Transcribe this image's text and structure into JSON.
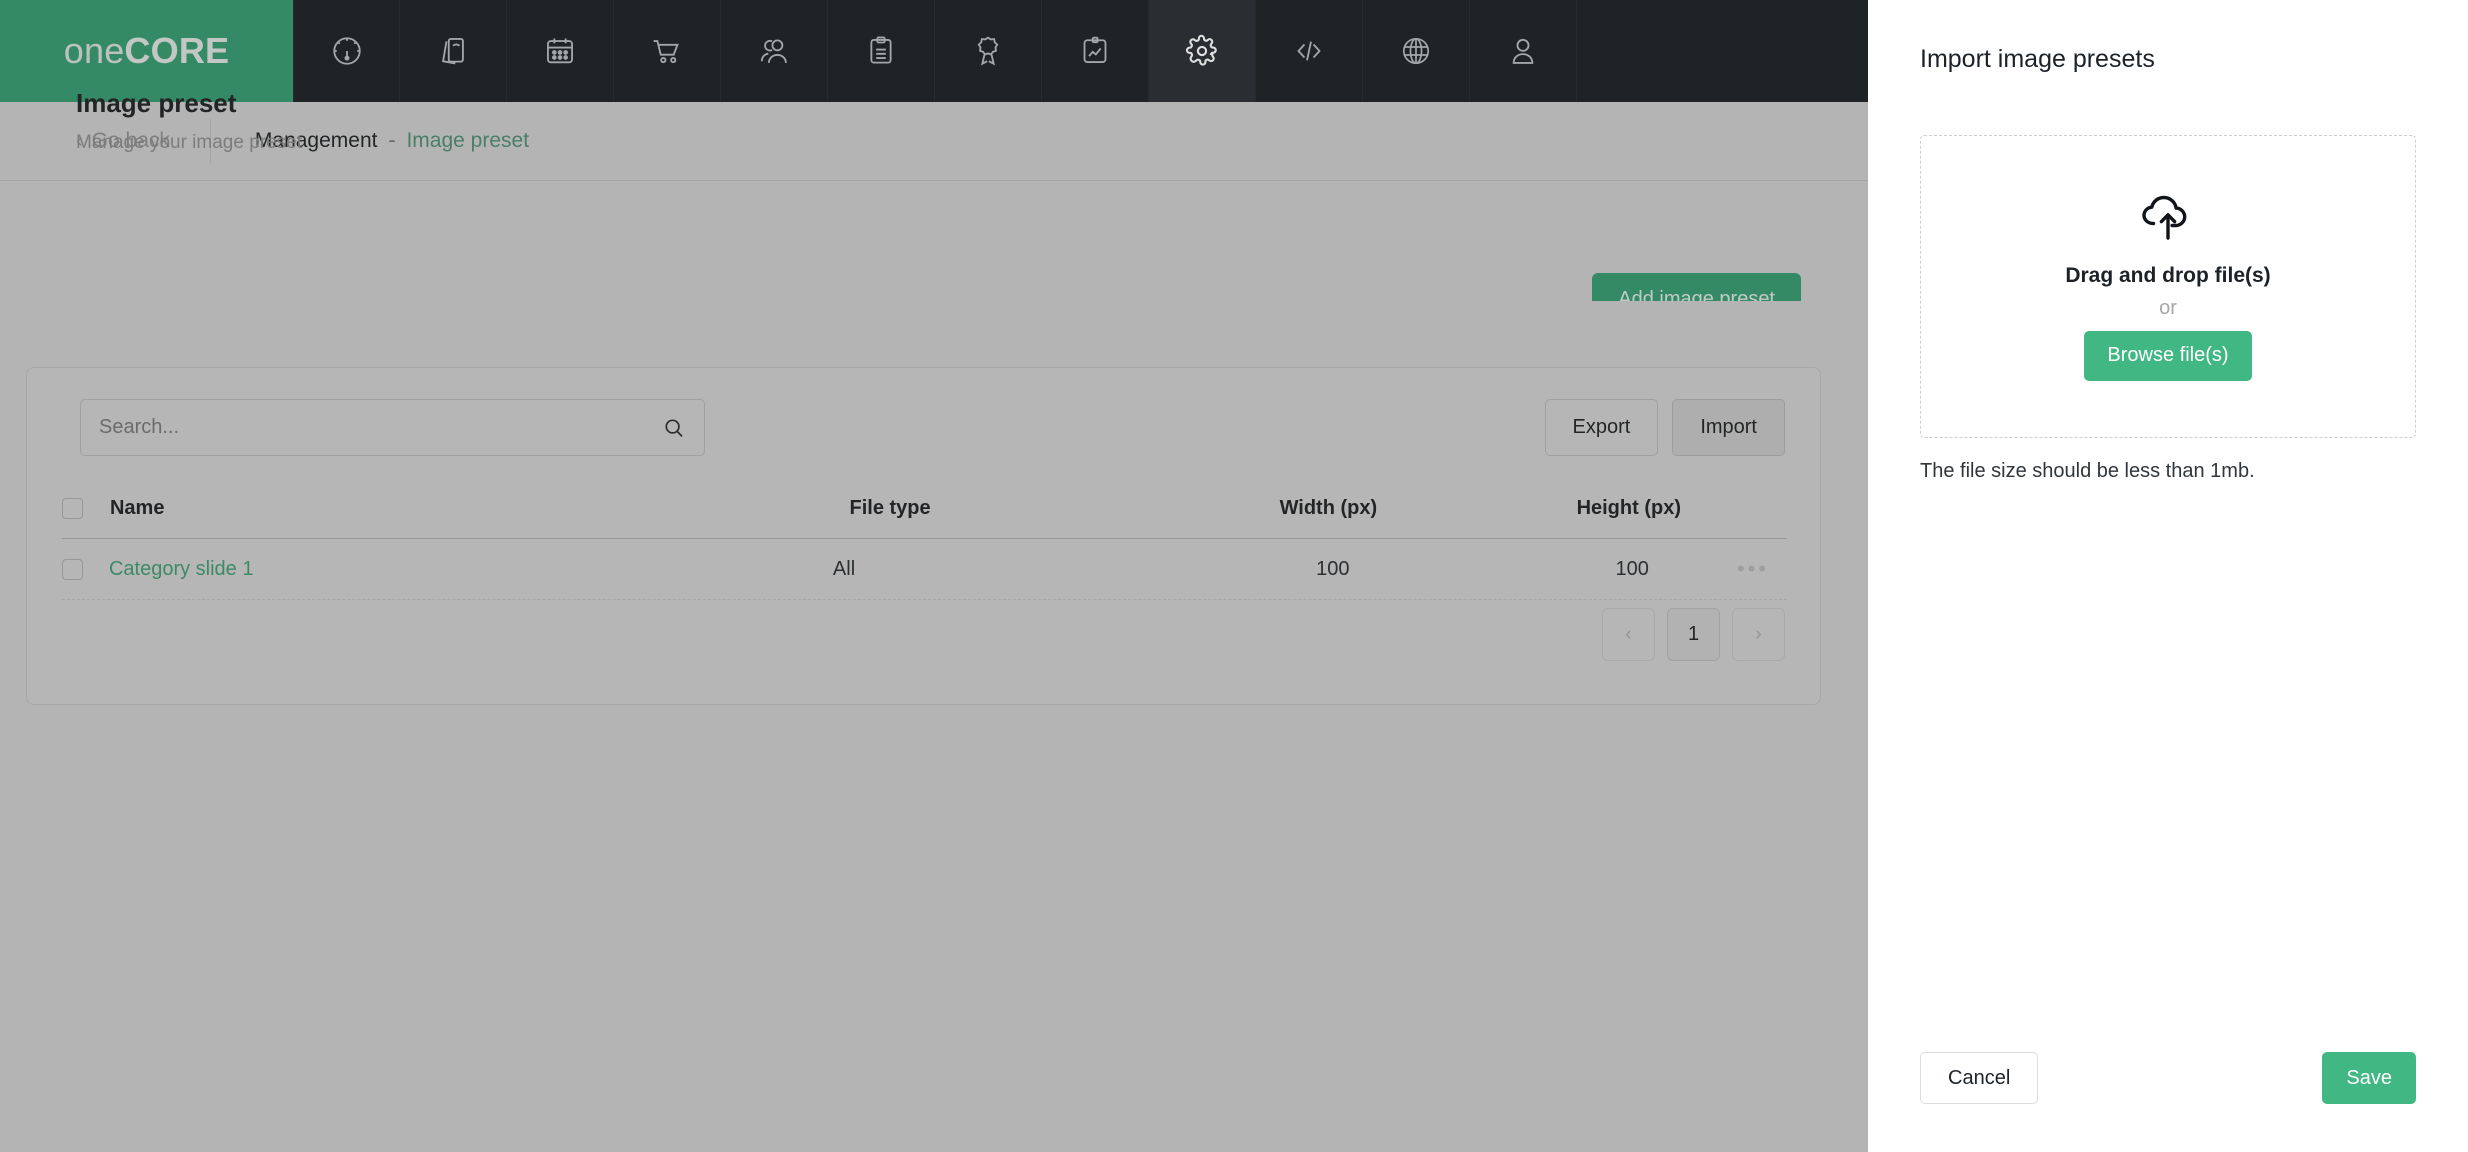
{
  "brand": {
    "prefix": "one",
    "suffix": "CORE"
  },
  "nav": {
    "items": [
      {
        "name": "dashboard",
        "icon": "speedometer-icon",
        "active": false
      },
      {
        "name": "catalog",
        "icon": "pages-icon",
        "active": false
      },
      {
        "name": "calendar",
        "icon": "calendar-icon",
        "active": false
      },
      {
        "name": "orders",
        "icon": "shopping-cart-icon",
        "active": false
      },
      {
        "name": "customers",
        "icon": "users-icon",
        "active": false
      },
      {
        "name": "tasks",
        "icon": "clipboard-list-icon",
        "active": false
      },
      {
        "name": "loyalty",
        "icon": "award-ribbon-icon",
        "active": false
      },
      {
        "name": "reports",
        "icon": "clipboard-chart-icon",
        "active": false
      },
      {
        "name": "settings",
        "icon": "gear-icon",
        "active": true
      },
      {
        "name": "developer",
        "icon": "code-icon",
        "active": false
      },
      {
        "name": "localization",
        "icon": "globe-icon",
        "active": false
      },
      {
        "name": "account",
        "icon": "user-icon",
        "active": false
      }
    ]
  },
  "breadcrumb": {
    "go_back": "Go back",
    "root": "Management",
    "separator": "-",
    "current": "Image preset"
  },
  "page": {
    "title": "Image preset",
    "subtitle": "Manage your image preset",
    "add_button": "Add image preset"
  },
  "toolbar": {
    "search_placeholder": "Search...",
    "search_value": "",
    "export_label": "Export",
    "import_label": "Import"
  },
  "table": {
    "columns": [
      "Name",
      "File type",
      "Width (px)",
      "Height (px)"
    ],
    "rows": [
      {
        "name": "Category slide 1",
        "file_type": "All",
        "width": "100",
        "height": "100"
      }
    ]
  },
  "pagination": {
    "prev": "‹",
    "current": "1",
    "next": "›"
  },
  "drawer": {
    "title": "Import image presets",
    "dropzone": {
      "icon": "cloud-upload-icon",
      "title": "Drag and drop file(s)",
      "or": "or",
      "browse_label": "Browse file(s)"
    },
    "note": "The file size should be less than 1mb.",
    "cancel_label": "Cancel",
    "save_label": "Save"
  },
  "colors": {
    "brand_green": "#339b6d",
    "accent_green": "#41b883",
    "navbar_dark": "#1b1f22",
    "page_grey": "#cdcdcd",
    "link_green": "#3e9a70"
  }
}
